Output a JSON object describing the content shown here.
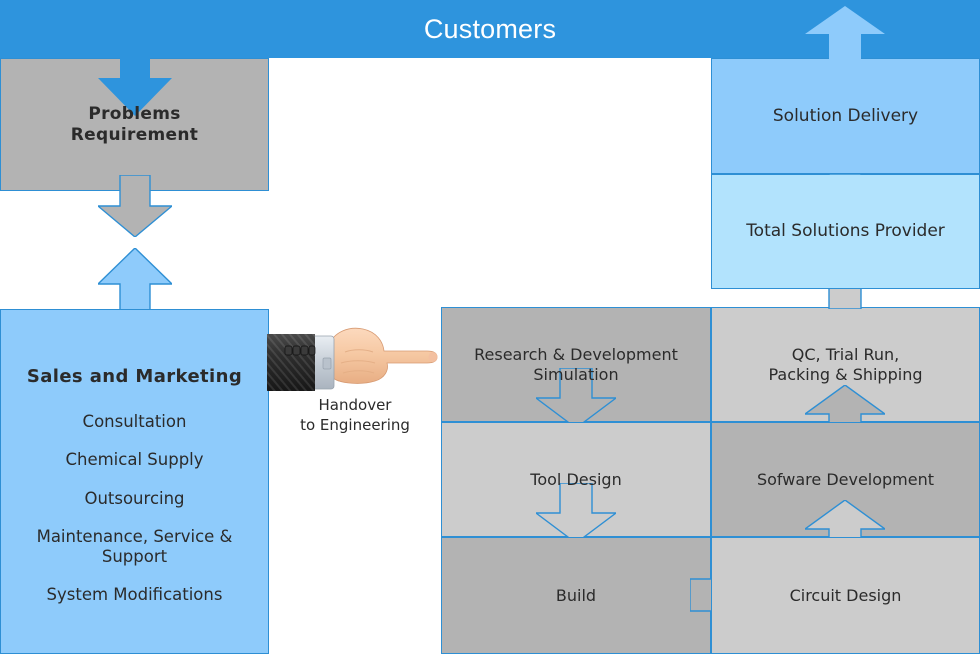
{
  "header": {
    "title": "Customers",
    "bg_color": "#2e94dd",
    "text_color": "#ffffff"
  },
  "colors": {
    "header_blue": "#2e94dd",
    "light_blue": "#8ecbfb",
    "pale_blue": "#b2e3fd",
    "gray_dark": "#b3b3b3",
    "gray_light": "#cccccc",
    "border_blue": "#2e8fd4",
    "text_dark": "#2b2b2b"
  },
  "left_column": {
    "problems_box": {
      "label": "Problems\nRequirement",
      "line1": "Problems",
      "line2": "Requirement",
      "fill": "#b3b3b3"
    },
    "sales_box": {
      "title": "Sales and Marketing",
      "fill": "#8ecbfb",
      "items": [
        {
          "label": "Consultation"
        },
        {
          "label": "Chemical Supply"
        },
        {
          "label": "Outsourcing"
        },
        {
          "label": "Maintenance, Service &\nSupport"
        },
        {
          "label": "System Modifications"
        }
      ]
    }
  },
  "handover": {
    "caption_line1": "Handover",
    "caption_line2": "to Engineering",
    "icon": "pointing-hand-icon"
  },
  "process_column": {
    "boxes": [
      {
        "label": "Research & Development\nSimulation",
        "fill": "#b3b3b3"
      },
      {
        "label": "Tool Design",
        "fill": "#cccccc"
      },
      {
        "label": "Build",
        "fill": "#b3b3b3"
      }
    ]
  },
  "output_column": {
    "boxes": [
      {
        "label": "QC, Trial Run,\nPacking & Shipping",
        "fill": "#cccccc"
      },
      {
        "label": "Sofware Development",
        "fill": "#b3b3b3"
      },
      {
        "label": "Circuit Design",
        "fill": "#cccccc"
      }
    ]
  },
  "right_column": {
    "boxes": [
      {
        "label": "Solution Delivery",
        "fill": "#8ecbfb"
      },
      {
        "label": "Total Solutions Provider",
        "fill": "#b2e3fd"
      }
    ]
  },
  "arrows": [
    {
      "name": "customers-to-problems",
      "direction": "down",
      "fill": "#2e94dd"
    },
    {
      "name": "problems-to-sales",
      "direction": "down",
      "fill": "#b3b3b3"
    },
    {
      "name": "sales-to-problems",
      "direction": "up",
      "fill": "#8ecbfb"
    },
    {
      "name": "rnd-to-tool",
      "direction": "down",
      "fill": "#b3b3b3"
    },
    {
      "name": "tool-to-build",
      "direction": "down",
      "fill": "#cccccc"
    },
    {
      "name": "build-to-circuit",
      "direction": "right",
      "fill": "#b3b3b3"
    },
    {
      "name": "circuit-to-software",
      "direction": "up",
      "fill": "#cccccc"
    },
    {
      "name": "software-to-qc",
      "direction": "up",
      "fill": "#b3b3b3"
    },
    {
      "name": "qc-to-total-solutions",
      "direction": "up",
      "fill": "#cccccc"
    },
    {
      "name": "total-solutions-to-delivery",
      "direction": "up",
      "fill": "#b2e3fd"
    },
    {
      "name": "delivery-to-customers",
      "direction": "up",
      "fill": "#8ecbfb"
    }
  ]
}
